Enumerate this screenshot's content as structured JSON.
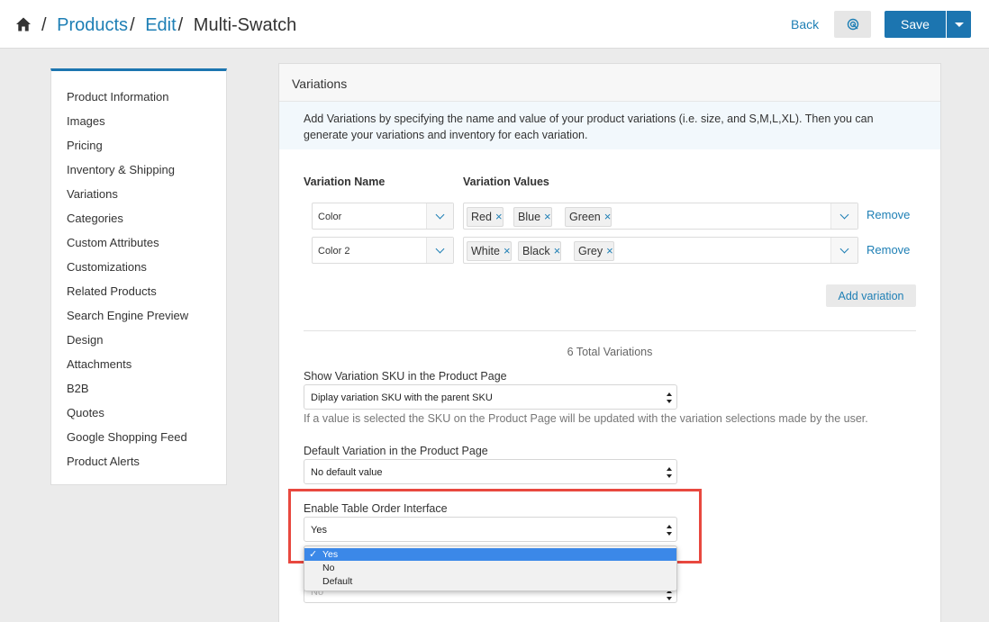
{
  "breadcrumb": {
    "items": [
      {
        "label": "Products"
      },
      {
        "label": "Edit"
      }
    ],
    "current": "Multi-Swatch",
    "separator": "/"
  },
  "header": {
    "back_label": "Back",
    "save_label": "Save",
    "preview_icon": "eye-target-icon"
  },
  "sidebar": {
    "items": [
      {
        "label": "Product Information"
      },
      {
        "label": "Images"
      },
      {
        "label": "Pricing"
      },
      {
        "label": "Inventory & Shipping"
      },
      {
        "label": "Variations"
      },
      {
        "label": "Categories"
      },
      {
        "label": "Custom Attributes"
      },
      {
        "label": "Customizations"
      },
      {
        "label": "Related Products"
      },
      {
        "label": "Search Engine Preview"
      },
      {
        "label": "Design"
      },
      {
        "label": "Attachments"
      },
      {
        "label": "B2B"
      },
      {
        "label": "Quotes"
      },
      {
        "label": "Google Shopping Feed"
      },
      {
        "label": "Product Alerts"
      }
    ]
  },
  "panel": {
    "title": "Variations",
    "info": "Add Variations by specifying the name and value of your product variations (i.e. size, and S,M,L,XL). Then you can generate your variations and inventory for each variation.",
    "col_name": "Variation Name",
    "col_values": "Variation Values",
    "rows": [
      {
        "name": "Color",
        "values": [
          "Red",
          "Blue",
          "Green"
        ],
        "remove": "Remove"
      },
      {
        "name": "Color 2",
        "values": [
          "White",
          "Black",
          "Grey"
        ],
        "remove": "Remove"
      }
    ],
    "tag_remove_glyph": "×",
    "add_variation": "Add variation",
    "total": "6 Total Variations",
    "sku": {
      "label": "Show Variation SKU in the Product Page",
      "value": "Diplay variation SKU with the parent SKU",
      "help": "If a value is selected the SKU on the Product Page will be updated with the variation selections made by the user."
    },
    "default_variation": {
      "label": "Default Variation in the Product Page",
      "value": "No default value"
    },
    "table_order": {
      "label": "Enable Table Order Interface",
      "value": "Yes",
      "options": [
        "Yes",
        "No",
        "Default"
      ],
      "selected_index": 0,
      "check_glyph": "✓"
    },
    "hidden_select_value": "No"
  },
  "colors": {
    "accent": "#1c75b0",
    "link": "#1e7fb5",
    "highlight": "#e8483f",
    "selected_option": "#3b88e8"
  }
}
